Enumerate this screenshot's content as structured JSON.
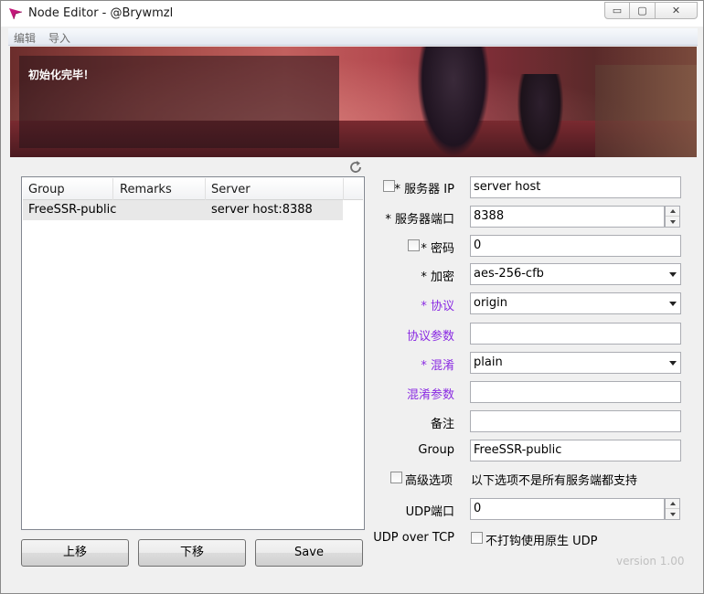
{
  "window": {
    "title": "Node Editor - @Brywmzl",
    "controls": {
      "minimize": "▭",
      "restore": "▢",
      "close": "✕"
    }
  },
  "menu": [
    "编辑",
    "导入"
  ],
  "banner": {
    "status_text": "初始化完毕！"
  },
  "server_list": {
    "columns": [
      "Group",
      "Remarks",
      "Server"
    ],
    "rows": [
      {
        "group": "FreeSSR-public",
        "remarks": "",
        "server": "server host:8388"
      }
    ]
  },
  "buttons": {
    "move_up": "上移",
    "move_down": "下移",
    "save": "Save"
  },
  "form": {
    "server_ip_label": "* 服务器 IP",
    "server_ip_value": "server host",
    "server_port_label": "* 服务器端口",
    "server_port_value": "8388",
    "password_label": "* 密码",
    "password_value": "0",
    "encryption_label": "* 加密",
    "encryption_value": "aes-256-cfb",
    "protocol_label": "* 协议",
    "protocol_value": "origin",
    "protocol_param_label": "协议参数",
    "protocol_param_value": "",
    "obfs_label": "* 混淆",
    "obfs_value": "plain",
    "obfs_param_label": "混淆参数",
    "obfs_param_value": "",
    "remarks_label": "备注",
    "remarks_value": "",
    "group_label": "Group",
    "group_value": "FreeSSR-public",
    "advanced_label": "高级选项",
    "advanced_note": "以下选项不是所有服务端都支持",
    "udp_port_label": "UDP端口",
    "udp_port_value": "0",
    "udp_over_tcp_label": "UDP over TCP",
    "no_patch_label": "不打钩使用原生 UDP"
  },
  "version": "version 1.00",
  "colors": {
    "accent_purple": "#8a2be2",
    "version_gray": "#c0c0c0"
  }
}
